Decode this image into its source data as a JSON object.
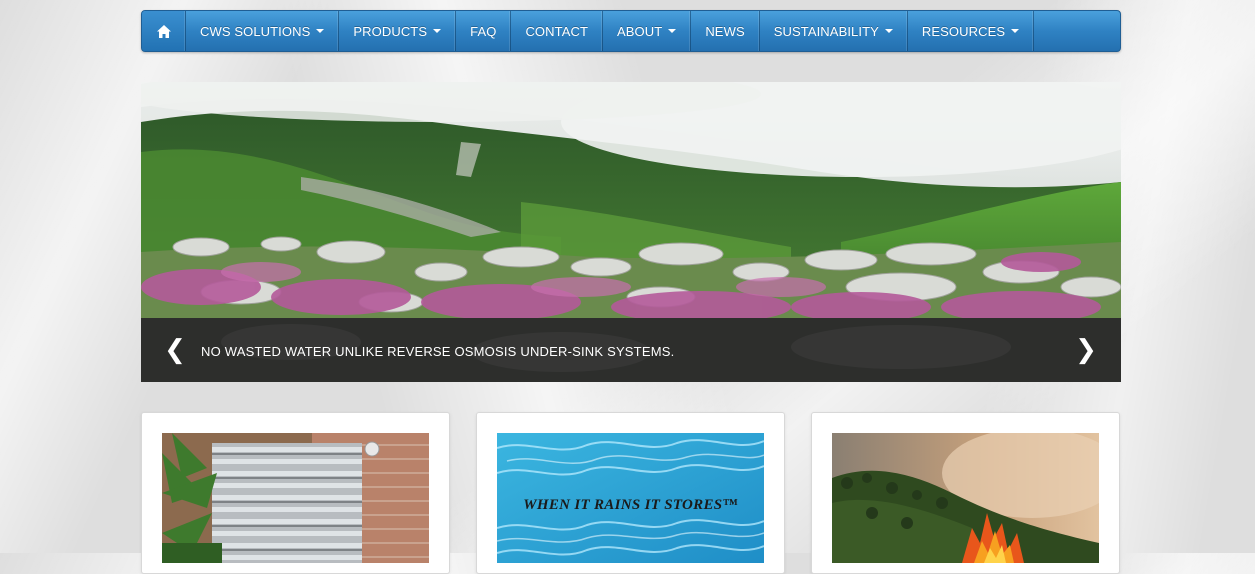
{
  "nav": {
    "home_icon": "home-icon",
    "items": [
      {
        "label": "CWS SOLUTIONS",
        "dropdown": true
      },
      {
        "label": "PRODUCTS",
        "dropdown": true
      },
      {
        "label": "FAQ",
        "dropdown": false
      },
      {
        "label": "CONTACT",
        "dropdown": false
      },
      {
        "label": "ABOUT",
        "dropdown": true
      },
      {
        "label": "NEWS",
        "dropdown": false
      },
      {
        "label": "SUSTAINABILITY",
        "dropdown": true
      },
      {
        "label": "RESOURCES",
        "dropdown": true
      }
    ]
  },
  "carousel": {
    "caption": "NO WASTED WATER UNLIKE REVERSE OSMOSIS UNDER-SINK SYSTEMS.",
    "prev_icon": "chevron-left-icon",
    "next_icon": "chevron-right-icon",
    "image": "mountain-valley-flowers"
  },
  "cards": [
    {
      "image": "corrugated-water-tank"
    },
    {
      "image": "pool-water",
      "overlay_text": "WHEN IT RAINS IT STORES™"
    },
    {
      "image": "forest-fire"
    }
  ],
  "colors": {
    "nav_blue": "#2f82c3",
    "caption_bg": "#0f0f0f"
  }
}
